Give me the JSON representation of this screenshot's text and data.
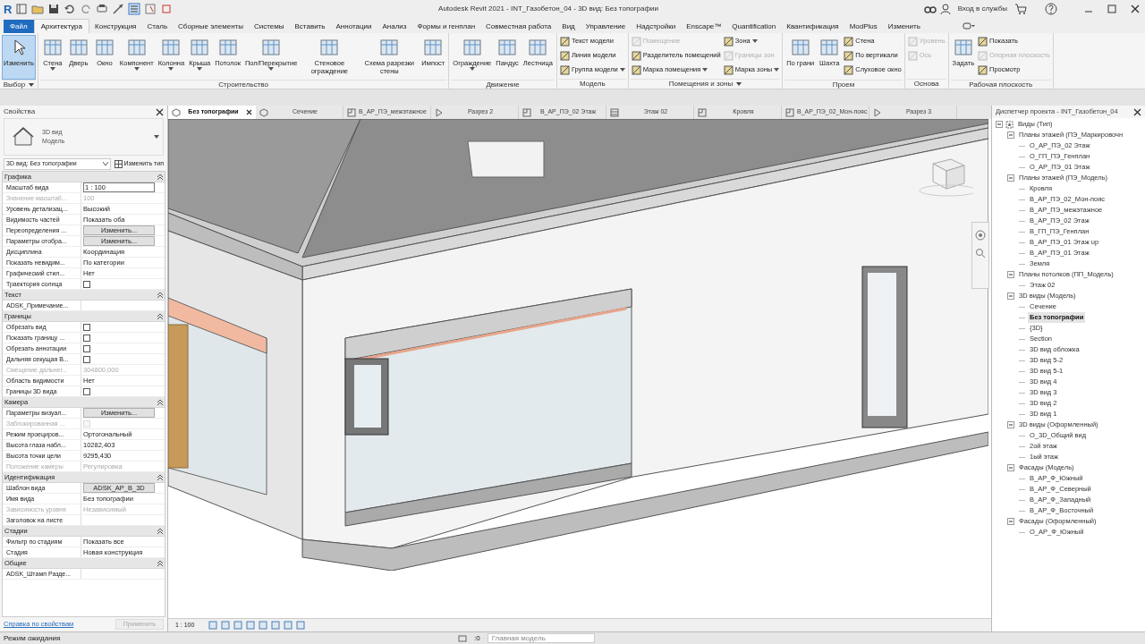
{
  "title_bar": {
    "app_logo": "R",
    "title": "Autodesk Revit 2021 - INT_Газобетон_04 - 3D вид: Без топографии",
    "sign_in": "Вход в службы"
  },
  "ribbon_tabs": [
    {
      "label": "Файл",
      "kind": "file",
      "selected": false
    },
    {
      "label": "Архитектура",
      "kind": "tab",
      "selected": true
    },
    {
      "label": "Конструкция",
      "kind": "tab",
      "selected": false
    },
    {
      "label": "Сталь",
      "kind": "tab",
      "selected": false
    },
    {
      "label": "Сборные элементы",
      "kind": "tab",
      "selected": false
    },
    {
      "label": "Системы",
      "kind": "tab",
      "selected": false
    },
    {
      "label": "Вставить",
      "kind": "tab",
      "selected": false
    },
    {
      "label": "Аннотации",
      "kind": "tab",
      "selected": false
    },
    {
      "label": "Анализ",
      "kind": "tab",
      "selected": false
    },
    {
      "label": "Формы и генплан",
      "kind": "tab",
      "selected": false
    },
    {
      "label": "Совместная работа",
      "kind": "tab",
      "selected": false
    },
    {
      "label": "Вид",
      "kind": "tab",
      "selected": false
    },
    {
      "label": "Управление",
      "kind": "tab",
      "selected": false
    },
    {
      "label": "Надстройки",
      "kind": "tab",
      "selected": false
    },
    {
      "label": "Enscape™",
      "kind": "tab",
      "selected": false
    },
    {
      "label": "Quantification",
      "kind": "tab",
      "selected": false
    },
    {
      "label": "Квантификация",
      "kind": "tab",
      "selected": false
    },
    {
      "label": "ModPlus",
      "kind": "tab",
      "selected": false
    },
    {
      "label": "Изменить",
      "kind": "tab",
      "selected": false
    }
  ],
  "ribbon_panels": [
    {
      "title": "Выбор",
      "has_menu": true,
      "items": [
        {
          "label": "Изменить",
          "kind": "large",
          "selected": true,
          "disabled": false,
          "dropdown": false
        }
      ]
    },
    {
      "title": "Строительство",
      "has_menu": false,
      "items": [
        {
          "label": "Стена",
          "kind": "large",
          "selected": false,
          "disabled": false,
          "dropdown": true
        },
        {
          "label": "Дверь",
          "kind": "large",
          "selected": false,
          "disabled": false,
          "dropdown": false
        },
        {
          "label": "Окно",
          "kind": "large",
          "selected": false,
          "disabled": false,
          "dropdown": false
        },
        {
          "label": "Компонент",
          "kind": "large",
          "selected": false,
          "disabled": false,
          "dropdown": true
        },
        {
          "label": "Колонна",
          "kind": "large",
          "selected": false,
          "disabled": false,
          "dropdown": true
        },
        {
          "label": "Крыша",
          "kind": "large",
          "selected": false,
          "disabled": false,
          "dropdown": true
        },
        {
          "label": "Потолок",
          "kind": "large",
          "selected": false,
          "disabled": false,
          "dropdown": false
        },
        {
          "label": "Пол/Перекрытие",
          "kind": "large",
          "selected": false,
          "disabled": false,
          "dropdown": true
        },
        {
          "label": "Стеновое ограждение",
          "kind": "large",
          "selected": false,
          "disabled": false,
          "dropdown": false
        },
        {
          "label": "Схема разрезки стены",
          "kind": "large",
          "selected": false,
          "disabled": false,
          "dropdown": false
        },
        {
          "label": "Импост",
          "kind": "large",
          "selected": false,
          "disabled": false,
          "dropdown": false
        }
      ]
    },
    {
      "title": "Движение",
      "has_menu": false,
      "items": [
        {
          "label": "Ограждение",
          "kind": "large",
          "selected": false,
          "disabled": false,
          "dropdown": true
        },
        {
          "label": "Пандус",
          "kind": "large",
          "selected": false,
          "disabled": false,
          "dropdown": false
        },
        {
          "label": "Лестница",
          "kind": "large",
          "selected": false,
          "disabled": false,
          "dropdown": false
        }
      ]
    },
    {
      "title": "Модель",
      "has_menu": false,
      "items": [
        {
          "label": "Текст модели",
          "kind": "small",
          "selected": false,
          "disabled": false,
          "dropdown": false
        },
        {
          "label": "Линия модели",
          "kind": "small",
          "selected": false,
          "disabled": false,
          "dropdown": false
        },
        {
          "label": "Группа модели",
          "kind": "small",
          "selected": false,
          "disabled": false,
          "dropdown": true
        }
      ]
    },
    {
      "title": "Помещения и зоны",
      "has_menu": true,
      "items": [
        {
          "label": "Помещение",
          "kind": "small",
          "selected": false,
          "disabled": true,
          "dropdown": false
        },
        {
          "label": "Разделитель помещений",
          "kind": "small",
          "selected": false,
          "disabled": false,
          "dropdown": false
        },
        {
          "label": "Марка помещения",
          "kind": "small",
          "selected": false,
          "disabled": false,
          "dropdown": true
        },
        {
          "label": "Зона",
          "kind": "small",
          "selected": false,
          "disabled": false,
          "dropdown": true
        },
        {
          "label": "Границы зон",
          "kind": "small",
          "selected": false,
          "disabled": true,
          "dropdown": false
        },
        {
          "label": "Марка зоны",
          "kind": "small",
          "selected": false,
          "disabled": false,
          "dropdown": true
        }
      ]
    },
    {
      "title": "Проем",
      "has_menu": false,
      "items": [
        {
          "label": "По грани",
          "kind": "large",
          "selected": false,
          "disabled": false,
          "dropdown": false
        },
        {
          "label": "Шахта",
          "kind": "large",
          "selected": false,
          "disabled": false,
          "dropdown": false
        },
        {
          "label": "Стена",
          "kind": "small",
          "selected": false,
          "disabled": false,
          "dropdown": false
        },
        {
          "label": "По вертикали",
          "kind": "small",
          "selected": false,
          "disabled": false,
          "dropdown": false
        },
        {
          "label": "Слуховое окно",
          "kind": "small",
          "selected": false,
          "disabled": false,
          "dropdown": false
        }
      ]
    },
    {
      "title": "Основа",
      "has_menu": false,
      "items": [
        {
          "label": "Уровень",
          "kind": "small",
          "selected": false,
          "disabled": true,
          "dropdown": false
        },
        {
          "label": "Ось",
          "kind": "small",
          "selected": false,
          "disabled": true,
          "dropdown": false
        }
      ]
    },
    {
      "title": "Рабочая плоскость",
      "has_menu": false,
      "items": [
        {
          "label": "Задать",
          "kind": "large",
          "selected": false,
          "disabled": false,
          "dropdown": false
        },
        {
          "label": "Показать",
          "kind": "small",
          "selected": false,
          "disabled": false,
          "dropdown": false
        },
        {
          "label": "Опорная плоскость",
          "kind": "small",
          "selected": false,
          "disabled": true,
          "dropdown": false
        },
        {
          "label": "Просмотр",
          "kind": "small",
          "selected": false,
          "disabled": false,
          "dropdown": false
        }
      ]
    }
  ],
  "properties": {
    "title": "Свойства",
    "type_lines": [
      "3D вид",
      "Модель"
    ],
    "instance": "3D вид: Без топографии",
    "edit_type": "Изменить тип",
    "groups": [
      {
        "name": "Графика",
        "rows": [
          {
            "label": "Масштаб вида",
            "kind": "input",
            "value": "1 : 100",
            "disabled": false
          },
          {
            "label": "Значение масштаб...",
            "kind": "text",
            "value": "100",
            "disabled": true
          },
          {
            "label": "Уровень детализац...",
            "kind": "text",
            "value": "Высокий",
            "disabled": false
          },
          {
            "label": "Видимость частей",
            "kind": "text",
            "value": "Показать оба",
            "disabled": false
          },
          {
            "label": "Переопределения ...",
            "kind": "button",
            "value": "Изменить...",
            "disabled": false
          },
          {
            "label": "Параметры отобра...",
            "kind": "button",
            "value": "Изменить...",
            "disabled": false
          },
          {
            "label": "Дисциплина",
            "kind": "text",
            "value": "Координация",
            "disabled": false
          },
          {
            "label": "Показать невидим...",
            "kind": "text",
            "value": "По категории",
            "disabled": false
          },
          {
            "label": "Графический стил...",
            "kind": "text",
            "value": "Нет",
            "disabled": false
          },
          {
            "label": "Траектория солнца",
            "kind": "checkbox",
            "checked": false,
            "disabled": false
          }
        ]
      },
      {
        "name": "Текст",
        "rows": [
          {
            "label": "ADSK_Примечание...",
            "kind": "text",
            "disabled": false
          }
        ]
      },
      {
        "name": "Границы",
        "rows": [
          {
            "label": "Обрезать вид",
            "kind": "checkbox",
            "checked": false,
            "disabled": false
          },
          {
            "label": "Показать границу ...",
            "kind": "checkbox",
            "checked": false,
            "disabled": false
          },
          {
            "label": "Обрезать аннотации",
            "kind": "checkbox",
            "checked": false,
            "disabled": false
          },
          {
            "label": "Дальняя секущая В...",
            "kind": "checkbox",
            "checked": false,
            "disabled": false
          },
          {
            "label": "Смещение дальнег...",
            "kind": "text",
            "value": "304800,000",
            "disabled": true
          },
          {
            "label": "Область видимости",
            "kind": "text",
            "value": "Нет",
            "disabled": false
          },
          {
            "label": "Границы 3D вида",
            "kind": "checkbox",
            "checked": false,
            "disabled": false
          }
        ]
      },
      {
        "name": "Камера",
        "rows": [
          {
            "label": "Параметры визуал...",
            "kind": "button",
            "value": "Изменить...",
            "disabled": false
          },
          {
            "label": "Заблокированная ...",
            "kind": "checkbox",
            "checked": false,
            "disabled": true
          },
          {
            "label": "Режим проециров...",
            "kind": "text",
            "value": "Ортогональный",
            "disabled": false
          },
          {
            "label": "Высота глаза набл...",
            "kind": "text",
            "value": "10282,403",
            "disabled": false
          },
          {
            "label": "Высота точки цели",
            "kind": "text",
            "value": "9295,430",
            "disabled": false
          },
          {
            "label": "Положение камеры",
            "kind": "text",
            "value": "Регулировка",
            "disabled": true
          }
        ]
      },
      {
        "name": "Идентификация",
        "rows": [
          {
            "label": "Шаблон вида",
            "kind": "button",
            "value": "ADSK_АР_В_3D",
            "disabled": false
          },
          {
            "label": "Имя вида",
            "kind": "text",
            "value": "Без топографии",
            "disabled": false
          },
          {
            "label": "Зависимость уровня",
            "kind": "text",
            "value": "Независимый",
            "disabled": true
          },
          {
            "label": "Заголовок на листе",
            "kind": "text",
            "disabled": false
          }
        ]
      },
      {
        "name": "Стадии",
        "rows": [
          {
            "label": "Фильтр по стадиям",
            "kind": "text",
            "value": "Показать все",
            "disabled": false
          },
          {
            "label": "Стадия",
            "kind": "text",
            "value": "Новая конструкция",
            "disabled": false
          }
        ]
      },
      {
        "name": "Общие",
        "rows": [
          {
            "label": "ADSK_Штамп Разде...",
            "kind": "text",
            "disabled": false
          }
        ]
      }
    ],
    "help_link": "Справка по свойствам",
    "apply_button": {
      "label": "Применить",
      "disabled": true
    }
  },
  "view_tabs": [
    {
      "label": "Без топографии",
      "kind": "model",
      "selected": true
    },
    {
      "label": "Сечение",
      "kind": "model",
      "selected": false
    },
    {
      "label": "В_АР_ПЭ_межэтажное",
      "kind": "plan",
      "selected": false
    },
    {
      "label": "Разрез 2",
      "kind": "section",
      "selected": false
    },
    {
      "label": "В_АР_ПЭ_02 Этаж",
      "kind": "plan",
      "selected": false
    },
    {
      "label": "Этаж 02",
      "kind": "ceiling",
      "selected": false
    },
    {
      "label": "Кровля",
      "kind": "plan",
      "selected": false
    },
    {
      "label": "В_АР_ПЭ_02_Мон-пояс",
      "kind": "plan",
      "selected": false
    },
    {
      "label": "Разрез 3",
      "kind": "section",
      "selected": false
    }
  ],
  "viewport": {
    "scale": "1 : 100"
  },
  "project_browser": {
    "title": "Диспетчер проекта - INT_Газобетон_04",
    "tree": [
      {
        "label": "Виды (Тип)",
        "expanded": true,
        "selected": false,
        "children": [
          {
            "label": "Планы этажей (ПЭ_Маркировочн",
            "expanded": true,
            "selected": false,
            "children": [
              {
                "label": "О_АР_ПЭ_02 Этаж",
                "selected": false
              },
              {
                "label": "О_ГП_ПЭ_Генплан",
                "selected": false
              },
              {
                "label": "О_АР_ПЭ_01 Этаж",
                "selected": false
              }
            ]
          },
          {
            "label": "Планы этажей (ПЭ_Модель)",
            "expanded": true,
            "selected": false,
            "children": [
              {
                "label": "Кровля",
                "selected": false
              },
              {
                "label": "В_АР_ПЭ_02_Мон-пояс",
                "selected": false
              },
              {
                "label": "В_АР_ПЭ_межэтажное",
                "selected": false
              },
              {
                "label": "В_АР_ПЭ_02 Этаж",
                "selected": false
              },
              {
                "label": "В_ГП_ПЭ_Генплан",
                "selected": false
              },
              {
                "label": "В_АР_ПЭ_01 Этаж up",
                "selected": false
              },
              {
                "label": "В_АР_ПЭ_01 Этаж",
                "selected": false
              },
              {
                "label": "Земля",
                "selected": false
              }
            ]
          },
          {
            "label": "Планы потолков (ПП_Модель)",
            "expanded": true,
            "selected": false,
            "children": [
              {
                "label": "Этаж 02",
                "selected": false
              }
            ]
          },
          {
            "label": "3D виды (Модель)",
            "expanded": true,
            "selected": false,
            "children": [
              {
                "label": "Сечение",
                "selected": false
              },
              {
                "label": "Без топографии",
                "selected": true
              },
              {
                "label": "{3D}",
                "selected": false
              },
              {
                "label": "Section",
                "selected": false
              },
              {
                "label": "3D вид обложка",
                "selected": false
              },
              {
                "label": "3D вид 5-2",
                "selected": false
              },
              {
                "label": "3D вид 5-1",
                "selected": false
              },
              {
                "label": "3D вид 4",
                "selected": false
              },
              {
                "label": "3D вид 3",
                "selected": false
              },
              {
                "label": "3D вид 2",
                "selected": false
              },
              {
                "label": "3D вид 1",
                "selected": false
              }
            ]
          },
          {
            "label": "3D виды (Оформленный)",
            "expanded": true,
            "selected": false,
            "children": [
              {
                "label": "О_3D_Общий вид",
                "selected": false
              },
              {
                "label": "2ой этаж",
                "selected": false
              },
              {
                "label": "1ый этаж",
                "selected": false
              }
            ]
          },
          {
            "label": "Фасады (Модель)",
            "expanded": true,
            "selected": false,
            "children": [
              {
                "label": "В_АР_Ф_Южный",
                "selected": false
              },
              {
                "label": "В_АР_Ф_Северный",
                "selected": false
              },
              {
                "label": "В_АР_Ф_Западный",
                "selected": false
              },
              {
                "label": "В_АР_Ф_Восточный",
                "selected": false
              }
            ]
          },
          {
            "label": "Фасады (Оформленный)",
            "expanded": true,
            "selected": false,
            "children": [
              {
                "label": "О_АР_Ф_Южный",
                "selected": false
              }
            ]
          }
        ]
      }
    ]
  },
  "status_bar": {
    "message": "Режим ожидания",
    "filter_count": ":0",
    "active_model": "Главная модель"
  }
}
